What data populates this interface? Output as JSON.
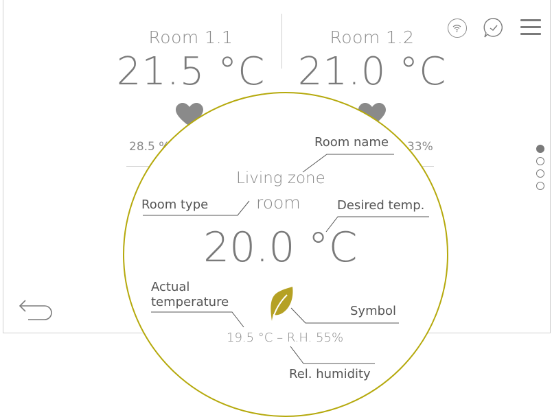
{
  "rooms": [
    {
      "name": "Room 1.1",
      "temp": "21.5 °C",
      "stat": "28.5 %"
    },
    {
      "name": "Room 1.2",
      "temp": "21.0 °C",
      "stat": "33%"
    }
  ],
  "header": {
    "wifi_icon": "wifi-icon",
    "message_icon": "message-check-icon",
    "menu_icon": "hamburger-menu-icon"
  },
  "pagination": {
    "count": 4,
    "active_index": 0
  },
  "nav": {
    "back_icon": "back-arrow-icon"
  },
  "zoom": {
    "room_name": "Living zone",
    "room_type": "room",
    "desired_temp": "20.0 °C",
    "actual": "19.5 °C – R.H. 55%",
    "symbol_icon": "leaf-icon",
    "labels": {
      "room_name": "Room name",
      "room_type": "Room type",
      "desired_temp": "Desired temp.",
      "actual_temp_line1": "Actual",
      "actual_temp_line2": "temperature",
      "symbol": "Symbol",
      "rel_humidity": "Rel. humidity"
    }
  },
  "colors": {
    "accent": "#b5a90c",
    "leaf": "#b5a124",
    "text": "#8a8a8a",
    "heart": "#8a8a8a"
  }
}
